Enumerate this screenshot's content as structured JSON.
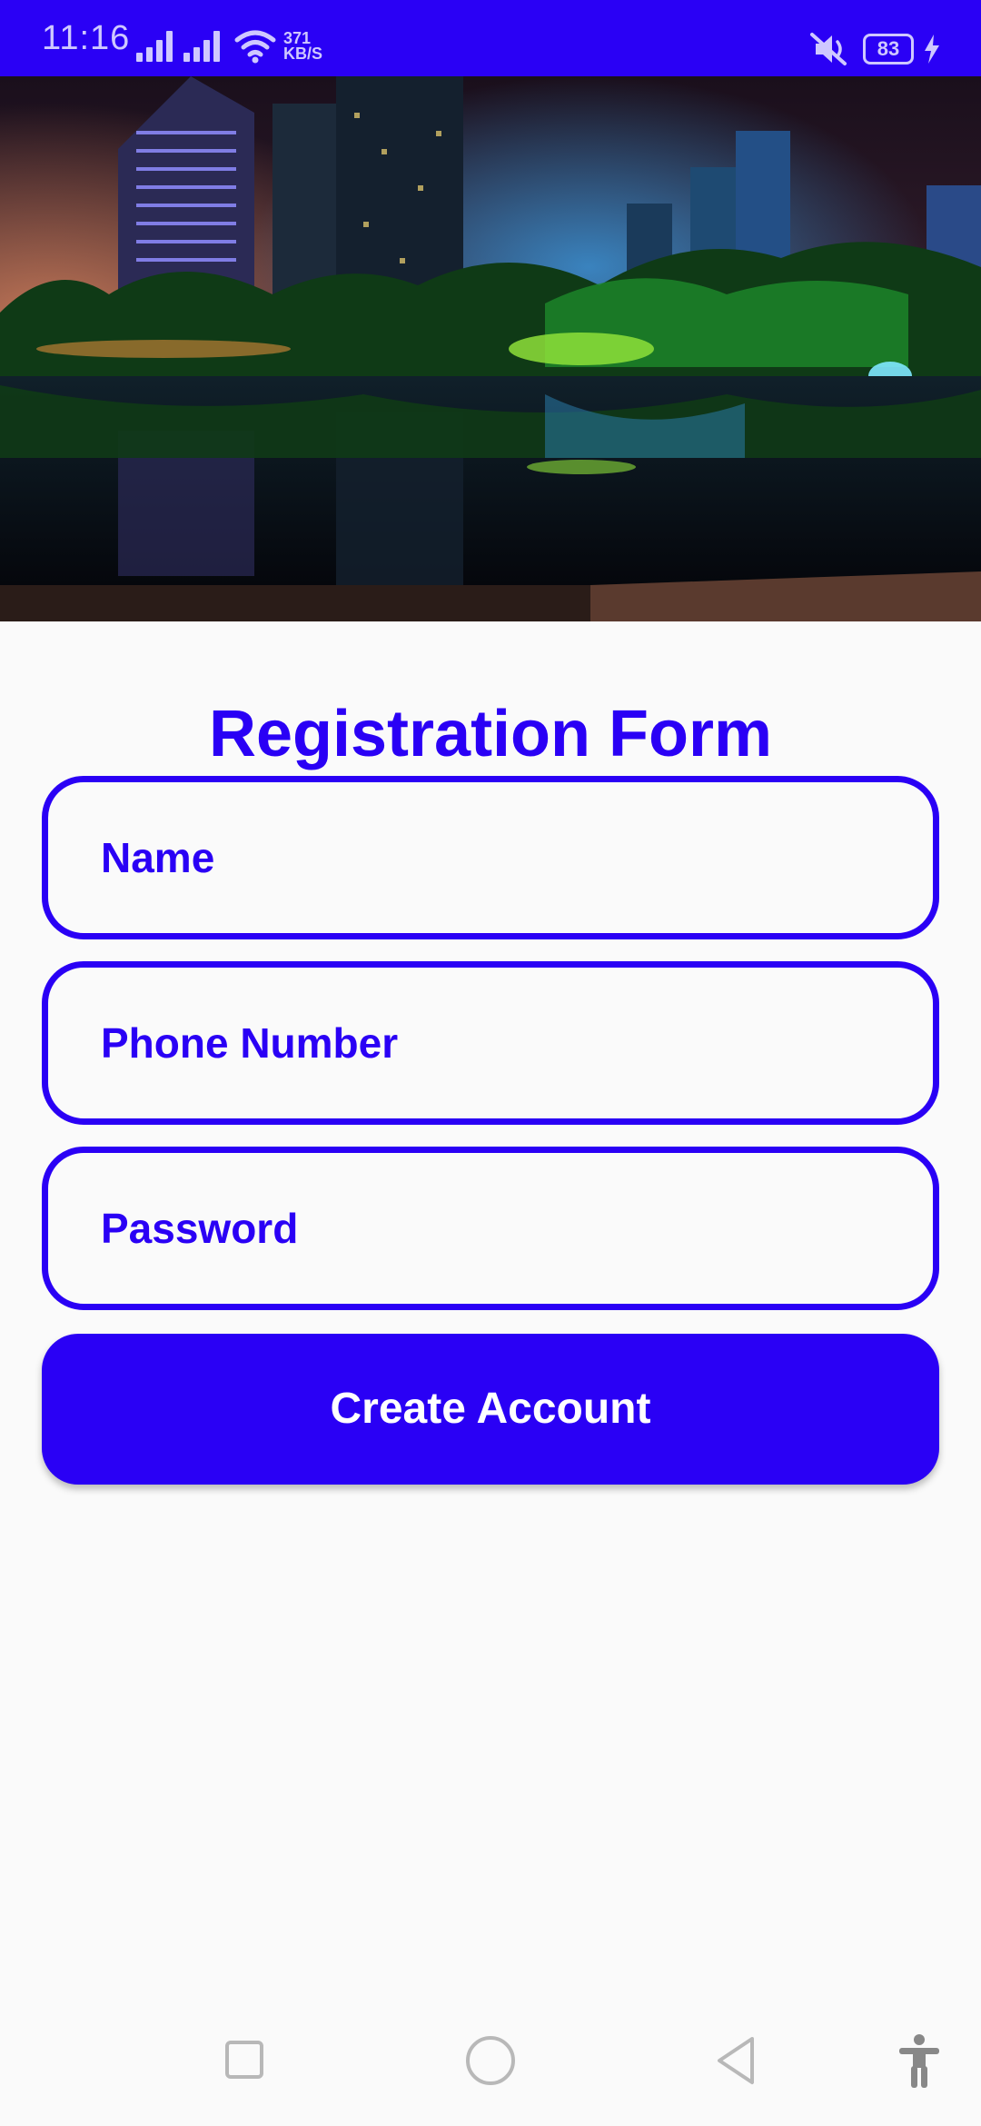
{
  "status_bar": {
    "time": "11:16",
    "speed_value": "371",
    "speed_unit": "KB/S",
    "battery": "83",
    "icons": [
      "signal-icon",
      "signal-icon",
      "wifi-icon",
      "mute-icon",
      "battery-icon",
      "charging-icon"
    ]
  },
  "hero": {
    "icon": "city-night-photo"
  },
  "form": {
    "title": "Registration Form",
    "name_placeholder": "Name",
    "phone_placeholder": "Phone Number",
    "password_placeholder": "Password",
    "submit_label": "Create Account"
  },
  "navigation": {
    "icons": [
      "recents-icon",
      "home-icon",
      "back-icon",
      "accessibility-icon"
    ]
  },
  "colors": {
    "accent": "#2a00f5",
    "background": "#fafafa",
    "button_text": "#ffffff"
  }
}
